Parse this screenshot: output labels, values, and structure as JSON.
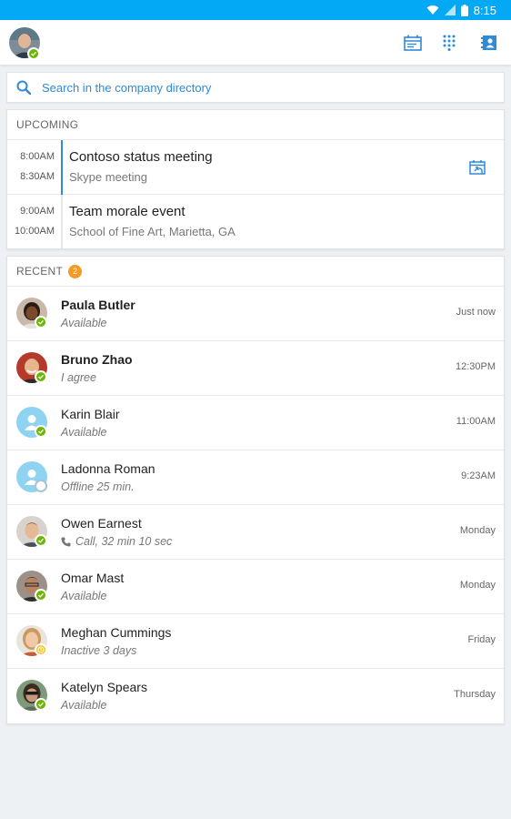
{
  "status_bar": {
    "time": "8:15"
  },
  "search": {
    "placeholder": "Search in the company directory"
  },
  "upcoming": {
    "header": "UPCOMING",
    "meetings": [
      {
        "start": "8:00AM",
        "end": "8:30AM",
        "title": "Contoso status meeting",
        "subtitle": "Skype meeting"
      },
      {
        "start": "9:00AM",
        "end": "10:00AM",
        "title": "Team morale event",
        "subtitle": "School of Fine Art, Marietta, GA"
      }
    ]
  },
  "recent": {
    "header": "RECENT",
    "badge": "2",
    "contacts": [
      {
        "name": "Paula Butler",
        "status": "Available",
        "time": "Just now",
        "presence": "available"
      },
      {
        "name": "Bruno Zhao",
        "status": "I agree",
        "time": "12:30PM",
        "presence": "available"
      },
      {
        "name": "Karin Blair",
        "status": "Available",
        "time": "11:00AM",
        "presence": "available"
      },
      {
        "name": "Ladonna Roman",
        "status": "Offline 25 min.",
        "time": "9:23AM",
        "presence": "offline"
      },
      {
        "name": "Owen Earnest",
        "status": "Call, 32 min 10 sec",
        "time": "Monday",
        "presence": "available"
      },
      {
        "name": "Omar Mast",
        "status": "Available",
        "time": "Monday",
        "presence": "available"
      },
      {
        "name": "Meghan Cummings",
        "status": "Inactive 3 days",
        "time": "Friday",
        "presence": "inactive"
      },
      {
        "name": "Katelyn Spears",
        "status": "Available",
        "time": "Thursday",
        "presence": "available"
      }
    ]
  },
  "colors": {
    "accent": "#03a9f4",
    "link": "#2f8ad8",
    "available": "#6bb700",
    "inactive": "#f8c21a",
    "badge": "#f59a23"
  },
  "icons": [
    "wifi-icon",
    "signal-icon",
    "battery-icon",
    "meetings-icon",
    "dialpad-icon",
    "contacts-icon",
    "search-icon",
    "join-meeting-icon",
    "phone-icon"
  ]
}
